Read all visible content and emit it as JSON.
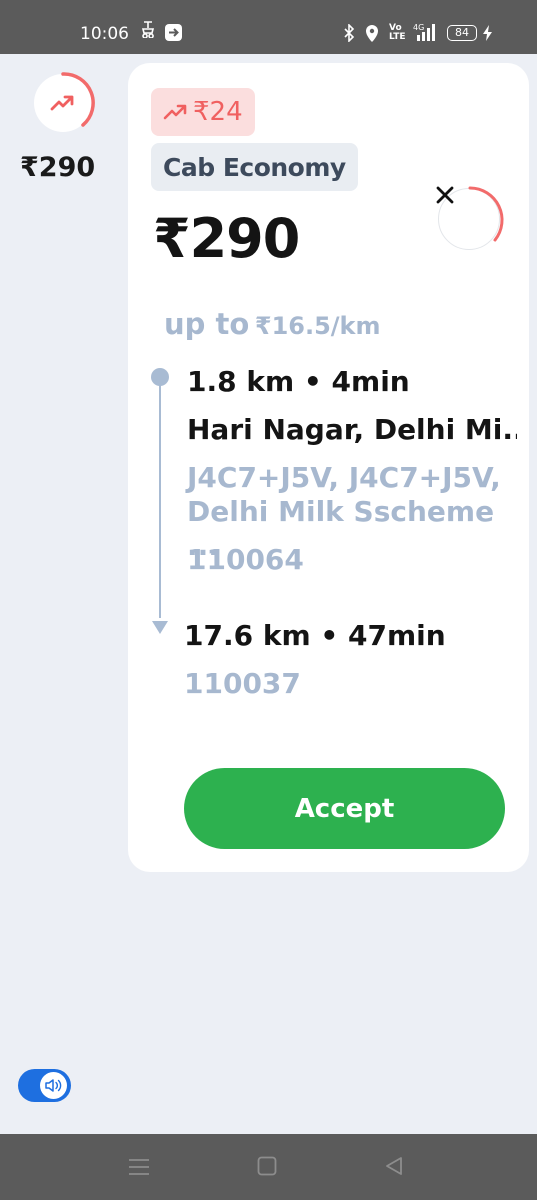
{
  "status_bar": {
    "time": "10:06",
    "battery": "84",
    "network": "4G"
  },
  "side_panel": {
    "price": "₹290",
    "icon": "trending-up-icon"
  },
  "card": {
    "surge_label": "₹24",
    "category": "Cab Economy",
    "fare": "₹290",
    "rate_prefix": "up to",
    "rate_value": "₹16.5/km",
    "pickup": {
      "meta": "1.8 km • 4min",
      "title": "Hari Nagar, Delhi Mi...",
      "address": "J4C7+J5V, J4C7+J5V, Delhi Milk Sscheme ...",
      "pincode": "110064"
    },
    "drop": {
      "meta": "17.6 km • 47min",
      "pincode": "110037"
    },
    "accept_label": "Accept"
  },
  "colors": {
    "accent_green": "#2db14f",
    "surge_red": "#f06060",
    "muted_blue": "#a7b8cf",
    "toggle_blue": "#1e6fe0"
  }
}
